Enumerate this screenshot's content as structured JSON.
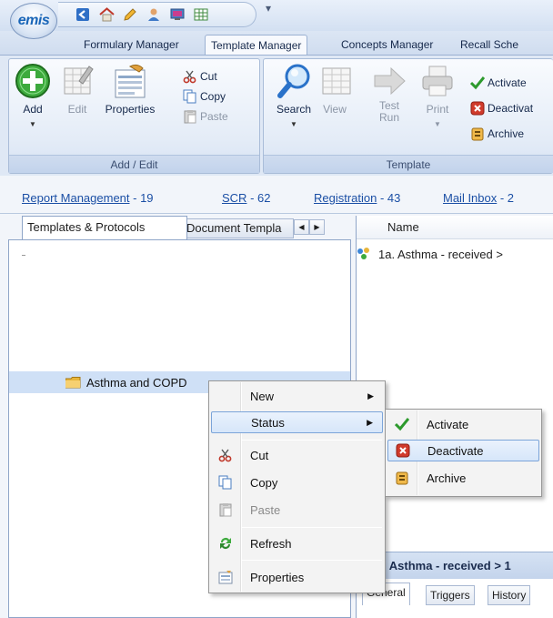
{
  "app": {
    "logo_text": "emis",
    "qat_dropdown": "▾"
  },
  "tabs": [
    {
      "label": "Formulary Manager"
    },
    {
      "label": "Template Manager"
    },
    {
      "label": "Concepts Manager"
    },
    {
      "label": "Recall Sche"
    }
  ],
  "ribbon": {
    "add": "Add",
    "edit": "Edit",
    "properties": "Properties",
    "cut": "Cut",
    "copy": "Copy",
    "paste": "Paste",
    "group_add_edit": "Add / Edit",
    "search": "Search",
    "view": "View",
    "test_run_1": "Test",
    "test_run_2": "Run",
    "print": "Print",
    "activate": "Activate",
    "deactivate": "Deactivat",
    "archive": "Archive",
    "group_template": "Template"
  },
  "links": [
    {
      "label": "Report Management",
      "count": " - 19"
    },
    {
      "label": "SCR",
      "count": " - 62"
    },
    {
      "label": "Registration",
      "count": " - 43"
    },
    {
      "label": "Mail Inbox",
      "count": " - 2"
    }
  ],
  "left_tabs": {
    "active": "Templates & Protocols",
    "inactive": "Document Templa"
  },
  "tree": {
    "folder_label": "Asthma and COPD"
  },
  "right": {
    "column_name": "Name",
    "row_text": "1a. Asthma - received >",
    "detail_title": ". Asthma - received > 1",
    "detail_tabs": [
      "General",
      "Triggers",
      "History"
    ]
  },
  "context_menu": {
    "new": "New",
    "status": "Status",
    "cut": "Cut",
    "copy": "Copy",
    "paste": "Paste",
    "refresh": "Refresh",
    "properties": "Properties"
  },
  "status_submenu": {
    "activate": "Activate",
    "deactivate": "Deactivate",
    "archive": "Archive"
  },
  "colors": {
    "accent": "#1b4fa5",
    "highlight": "#d6e6fa",
    "tree_selection": "#cfe0f6"
  }
}
